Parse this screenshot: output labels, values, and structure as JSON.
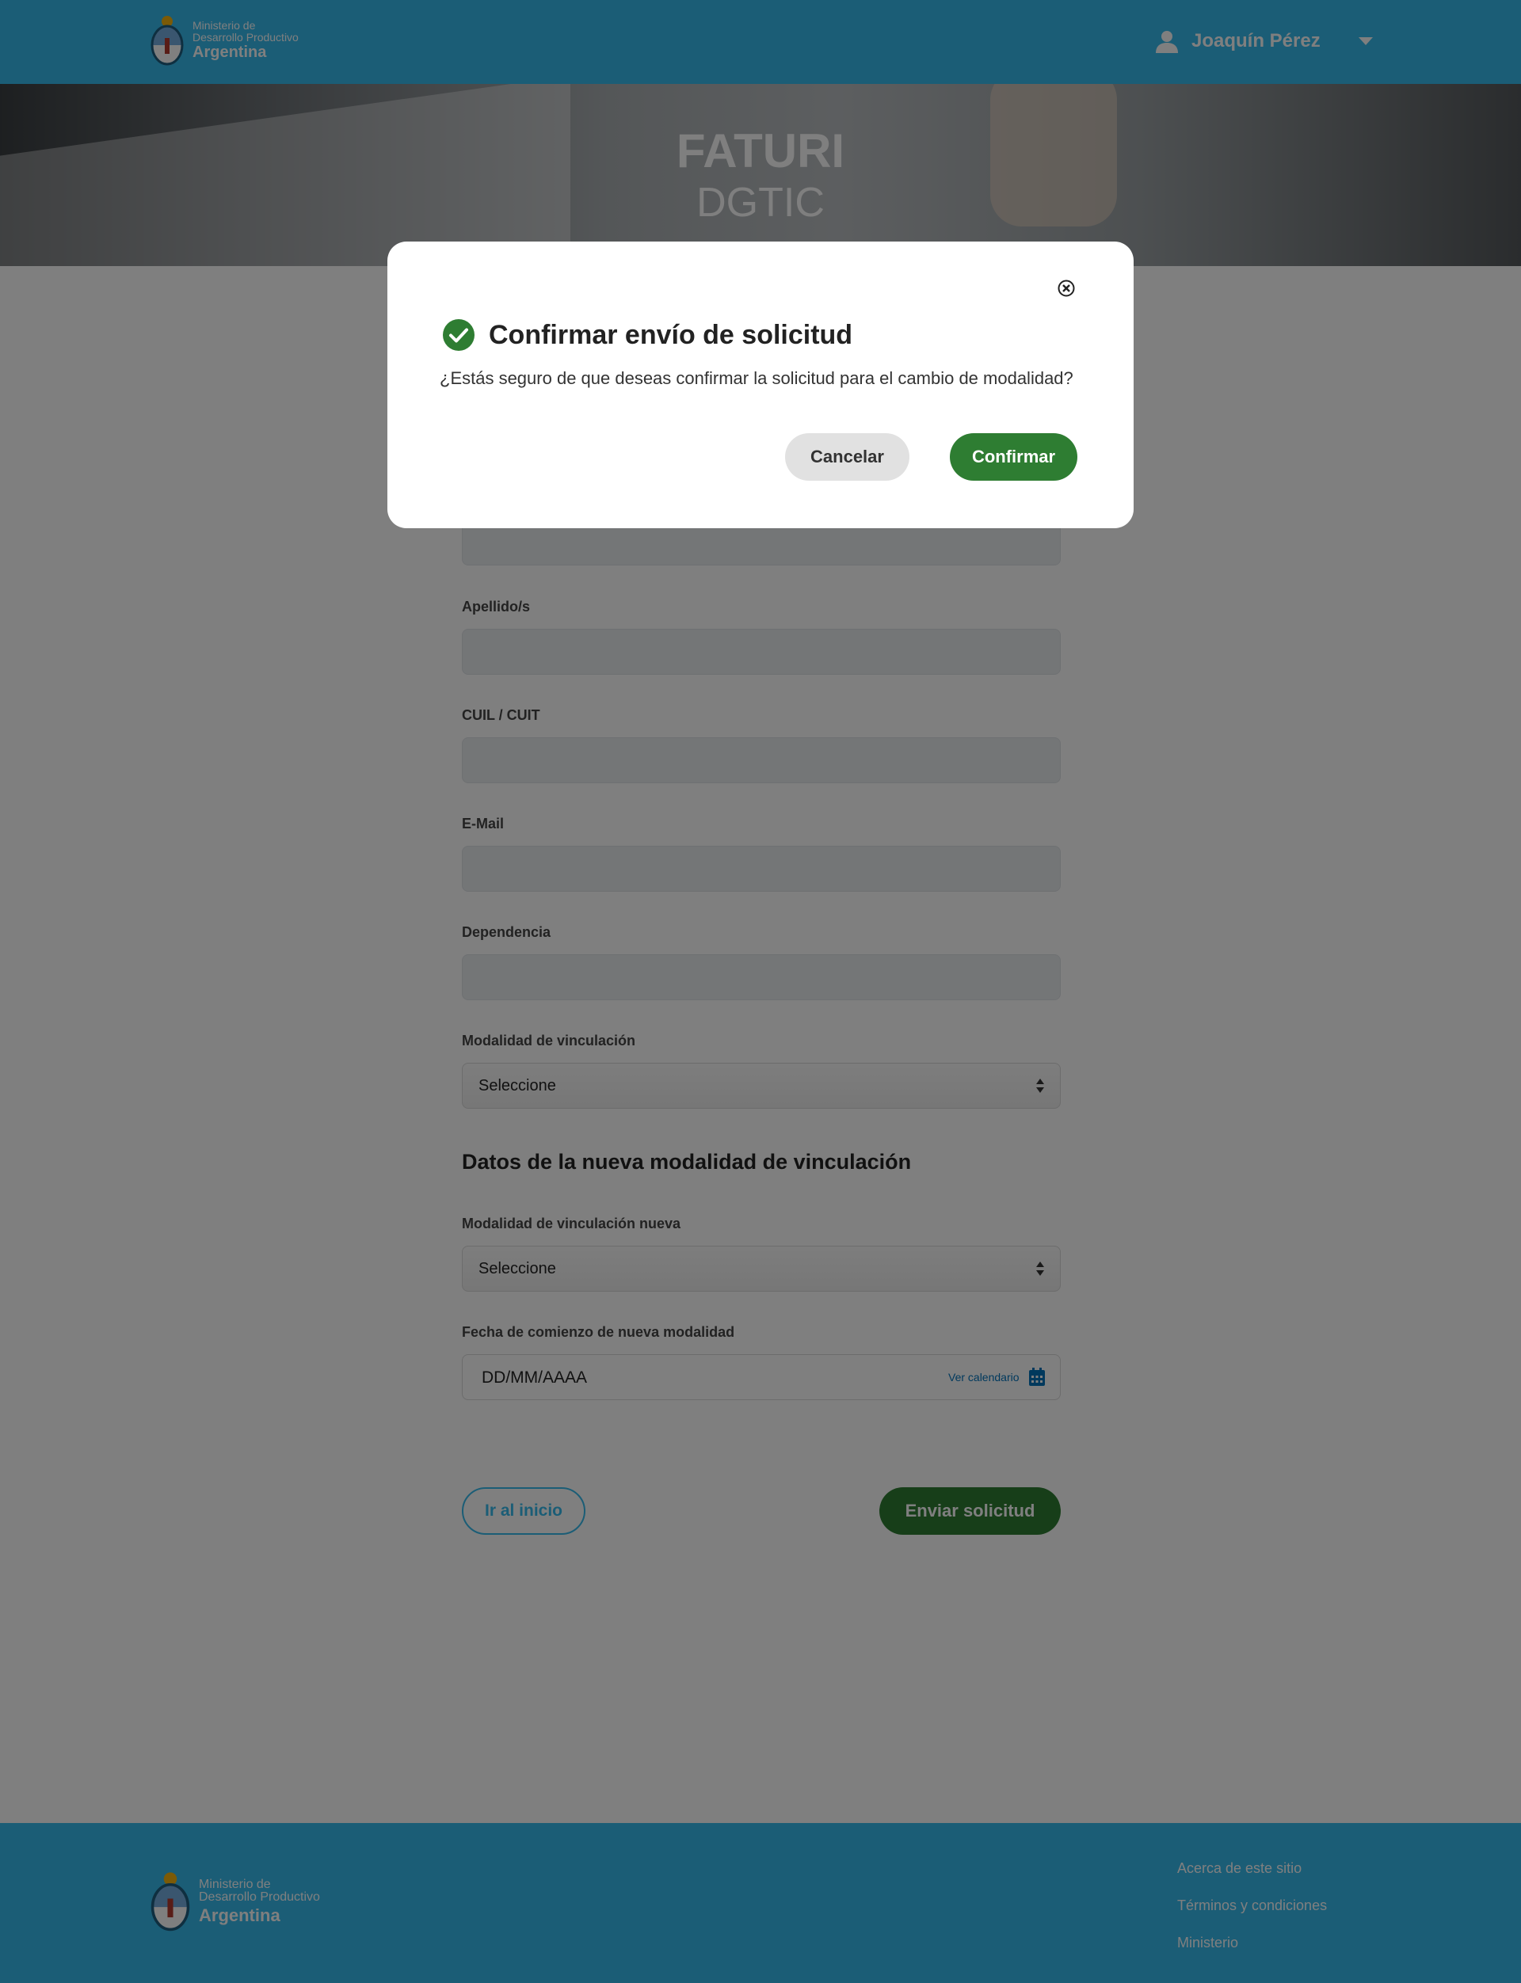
{
  "header": {
    "logo": {
      "line1": "Ministerio de",
      "line2": "Desarrollo Productivo",
      "line3": "Argentina"
    },
    "user_name": "Joaquín Pérez"
  },
  "hero": {
    "title": "FATURI",
    "subtitle": "DGTIC"
  },
  "form": {
    "fields": {
      "apellido_label": "Apellido/s",
      "cuil_label": "CUIL / CUIT",
      "email_label": "E-Mail",
      "dependencia_label": "Dependencia",
      "modalidad_label": "Modalidad de vinculación",
      "modalidad_value": "Seleccione"
    },
    "new_section": {
      "heading": "Datos de la nueva modalidad de vinculación",
      "modalidad_nueva_label": "Modalidad de vinculación nueva",
      "modalidad_nueva_value": "Seleccione",
      "fecha_label": "Fecha de comienzo de nueva modalidad",
      "fecha_placeholder": "DD/MM/AAAA",
      "calendar_link": "Ver calendario"
    },
    "buttons": {
      "home": "Ir al inicio",
      "send": "Enviar solicitud"
    }
  },
  "footer": {
    "logo": {
      "line1": "Ministerio de",
      "line2": "Desarrollo Productivo",
      "line3": "Argentina"
    },
    "links": [
      "Acerca de este sitio",
      "Términos y condiciones",
      "Ministerio"
    ]
  },
  "modal": {
    "title": "Confirmar envío de solicitud",
    "message": "¿Estás seguro de que deseas confirmar la solicitud para el cambio de modalidad?",
    "cancel_label": "Cancelar",
    "confirm_label": "Confirmar"
  },
  "colors": {
    "brand_blue": "#37bbed",
    "success_green": "#2e7d32",
    "link_blue": "#0072bb",
    "overlay": "rgba(0,0,0,0.5)"
  },
  "icons": [
    "escudo-icon",
    "user-icon",
    "chevron-down-icon",
    "calendar-icon",
    "check-circle-icon",
    "close-circle-icon"
  ]
}
